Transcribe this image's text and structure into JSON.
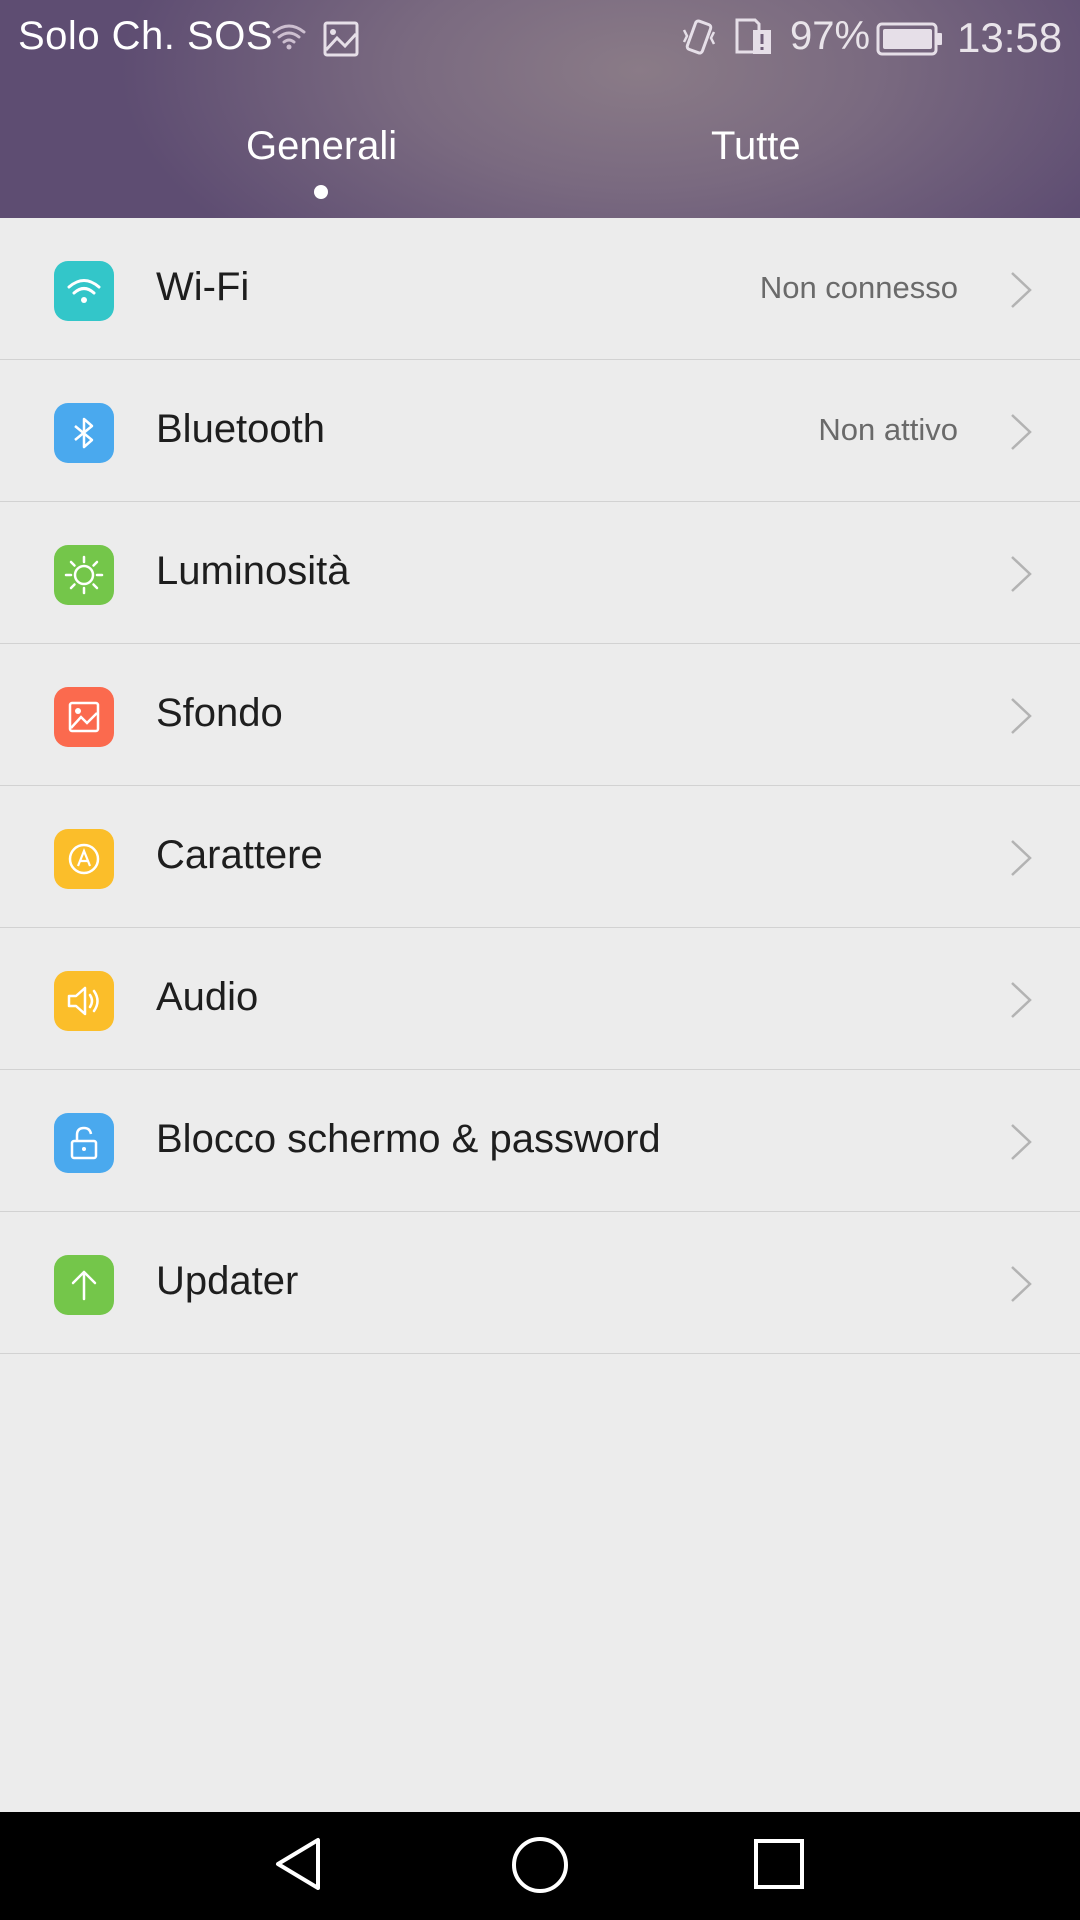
{
  "status_bar": {
    "carrier": "Solo Ch. SOS",
    "battery_percent": "97%",
    "time": "13:58",
    "icons": [
      "wifi-icon",
      "image-icon",
      "vibrate-icon",
      "sim-alert-icon",
      "battery-icon"
    ]
  },
  "tabs": [
    {
      "label": "Generali",
      "selected": true
    },
    {
      "label": "Tutte",
      "selected": false
    }
  ],
  "settings": [
    {
      "label": "Wi-Fi",
      "value": "Non connesso",
      "icon": "wifi-icon",
      "color": "#33c6c9"
    },
    {
      "label": "Bluetooth",
      "value": "Non attivo",
      "icon": "bluetooth-icon",
      "color": "#4aa9ee"
    },
    {
      "label": "Luminosità",
      "value": "",
      "icon": "brightness-icon",
      "color": "#74c64a"
    },
    {
      "label": "Sfondo",
      "value": "",
      "icon": "wallpaper-icon",
      "color": "#fb6a4e"
    },
    {
      "label": "Carattere",
      "value": "",
      "icon": "font-icon",
      "color": "#fbbe2a"
    },
    {
      "label": "Audio",
      "value": "",
      "icon": "speaker-icon",
      "color": "#fbbe2a"
    },
    {
      "label": "Blocco schermo & password",
      "value": "",
      "icon": "lock-icon",
      "color": "#4aa9ee"
    },
    {
      "label": "Updater",
      "value": "",
      "icon": "update-arrow-icon",
      "color": "#74c64a"
    }
  ],
  "navigation_bar": {
    "buttons": [
      "back-icon",
      "home-icon",
      "recents-icon"
    ]
  }
}
